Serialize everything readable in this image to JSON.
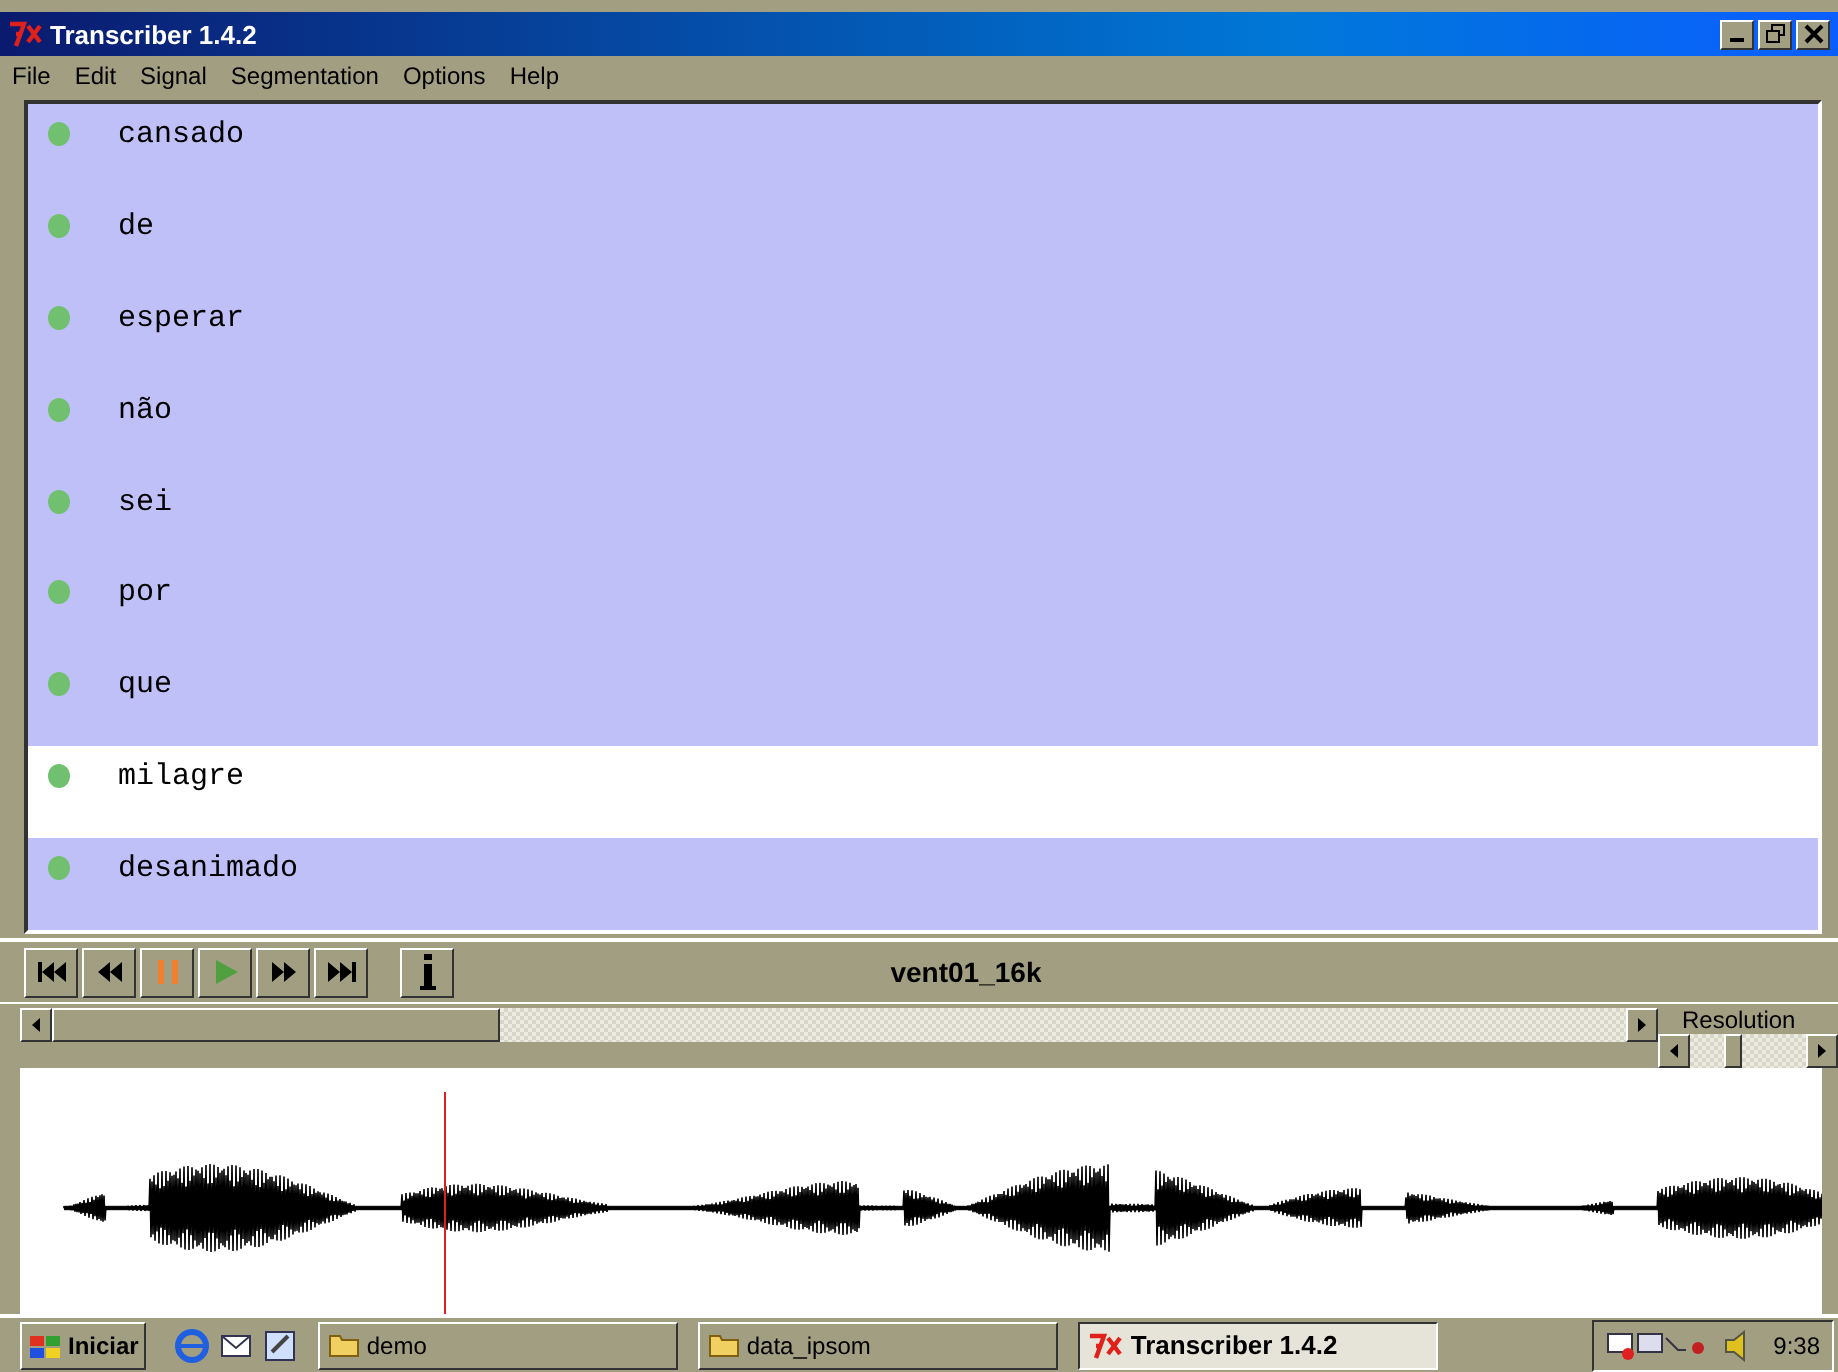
{
  "window": {
    "title": "Transcriber 1.4.2"
  },
  "menu": [
    "File",
    "Edit",
    "Signal",
    "Segmentation",
    "Options",
    "Help"
  ],
  "segments": [
    {
      "text": "cansado",
      "selected": false
    },
    {
      "text": "de",
      "selected": false
    },
    {
      "text": "esperar",
      "selected": false
    },
    {
      "text": "não",
      "selected": false
    },
    {
      "text": "sei",
      "selected": false
    },
    {
      "text": "por",
      "selected": false
    },
    {
      "text": "que",
      "selected": false
    },
    {
      "text": "milagre",
      "selected": true
    },
    {
      "text": "desanimado",
      "selected": false
    }
  ],
  "player": {
    "file_name": "vent01_16k",
    "resolution": {
      "label": "Resolution",
      "level": 0.35
    }
  },
  "taskbar": {
    "start": "Iniciar",
    "tasks": [
      {
        "label": "demo",
        "kind": "folder",
        "selected": false
      },
      {
        "label": "data_ipsom",
        "kind": "folder",
        "selected": false
      },
      {
        "label": "Transcriber 1.4.2",
        "kind": "app",
        "selected": true
      }
    ],
    "clock": "9:38"
  }
}
